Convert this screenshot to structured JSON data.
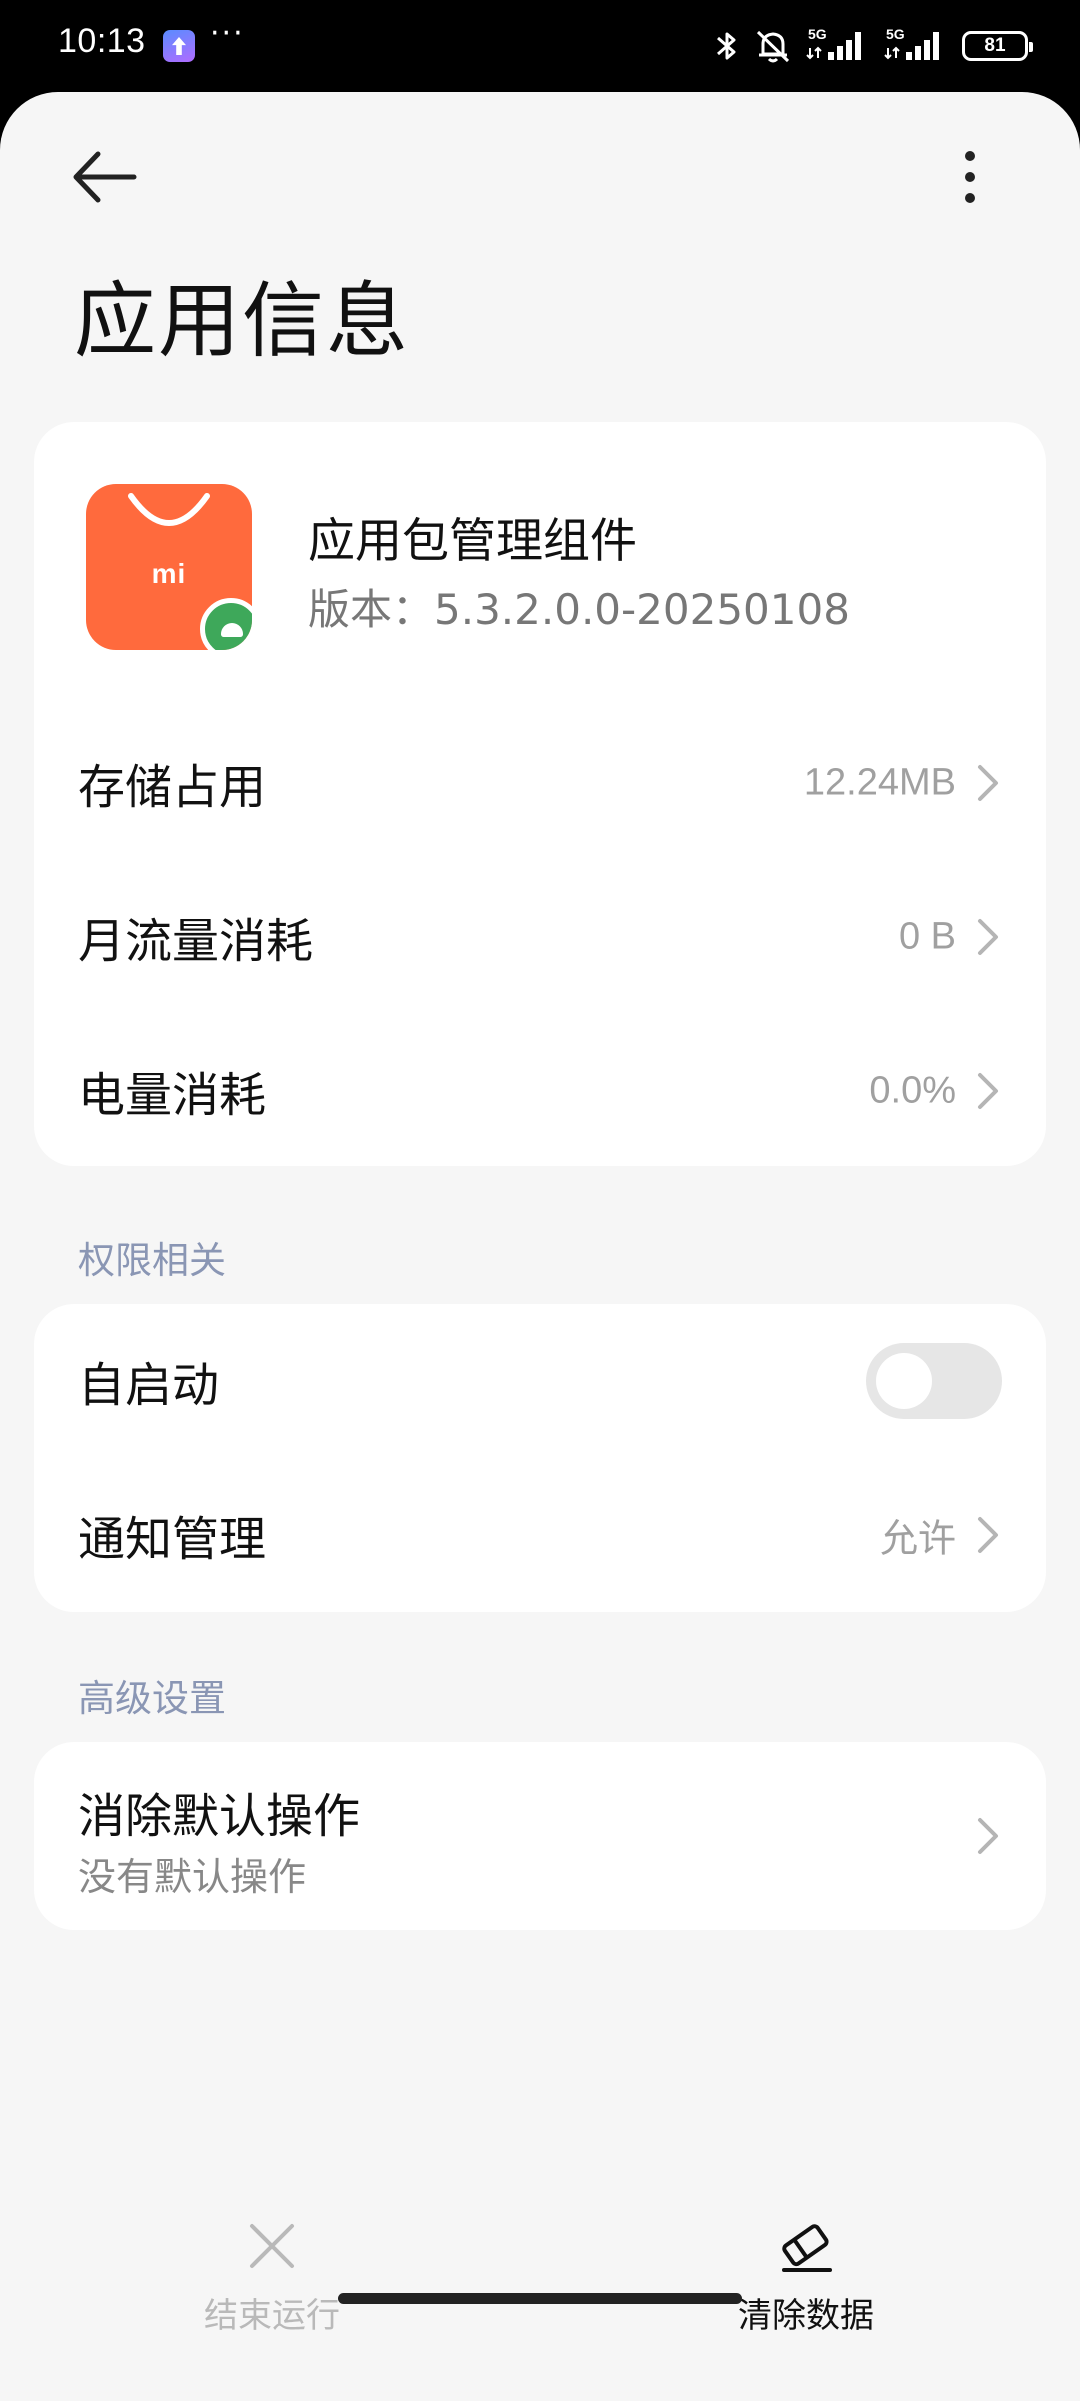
{
  "status_bar": {
    "time": "10:13",
    "more": "···",
    "network_1": "5G",
    "network_2": "5G",
    "battery": "81",
    "icons": [
      "bluetooth-icon",
      "mute-icon",
      "signal-icon",
      "battery-icon"
    ]
  },
  "header": {
    "title": "应用信息",
    "back_icon": "arrow-left-icon",
    "menu_icon": "more-vertical-icon"
  },
  "app": {
    "name": "应用包管理组件",
    "version": "版本：5.3.2.0.0-20250108",
    "icon_text": "mi",
    "accent_color": "#ff6a3d"
  },
  "usage": [
    {
      "label": "存储占用",
      "value": "12.24MB"
    },
    {
      "label": "月流量消耗",
      "value": "0 B"
    },
    {
      "label": "电量消耗",
      "value": "0.0%"
    }
  ],
  "permissions": {
    "header": "权限相关",
    "autostart": {
      "label": "自启动",
      "enabled": false
    },
    "notification": {
      "label": "通知管理",
      "value": "允许"
    }
  },
  "advanced": {
    "header": "高级设置",
    "clear_defaults": {
      "label": "消除默认操作",
      "sub": "没有默认操作"
    }
  },
  "bottom_bar": {
    "end": {
      "label": "结束运行",
      "enabled": false
    },
    "clear": {
      "label": "清除数据",
      "enabled": true
    }
  },
  "colors": {
    "background": "#f6f6f6",
    "card": "#ffffff",
    "section_header": "#8a96b4",
    "secondary_text": "#a0a0a0"
  }
}
